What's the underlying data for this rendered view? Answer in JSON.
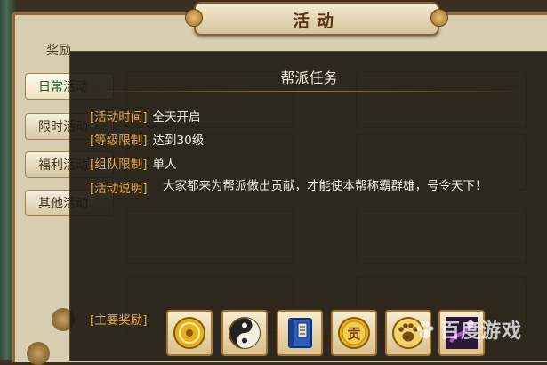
{
  "window": {
    "title": "活动",
    "reward_header": "奖励",
    "tabs": [
      {
        "label": "日常活动",
        "active": true
      },
      {
        "label": "限时活动",
        "active": false
      },
      {
        "label": "福利活动",
        "active": false
      },
      {
        "label": "其他活动",
        "active": false
      }
    ]
  },
  "popup": {
    "title": "帮派任务",
    "rows": [
      {
        "label": "[活动时间]",
        "value": "全天开启"
      },
      {
        "label": "[等级限制]",
        "value": "达到30级"
      },
      {
        "label": "[组队限制]",
        "value": "单人"
      }
    ],
    "desc_label": "[活动说明]",
    "desc_value": "大家都来为帮派做出贡献，才能使本帮称霸群雄，号令天下！",
    "rewards_label": "[主要奖励]",
    "rewards": [
      {
        "icon": "gold-coin-icon"
      },
      {
        "icon": "yin-yang-icon"
      },
      {
        "icon": "blue-book-icon"
      },
      {
        "icon": "contribution-coin-icon",
        "glyph": "贡"
      },
      {
        "icon": "paw-medal-icon"
      },
      {
        "icon": "purple-item-icon"
      }
    ]
  },
  "watermark": {
    "text": "百度游戏"
  },
  "colors": {
    "label": "#e7a94a",
    "text": "#f3efe4",
    "popup_bg": "#1c160e"
  }
}
